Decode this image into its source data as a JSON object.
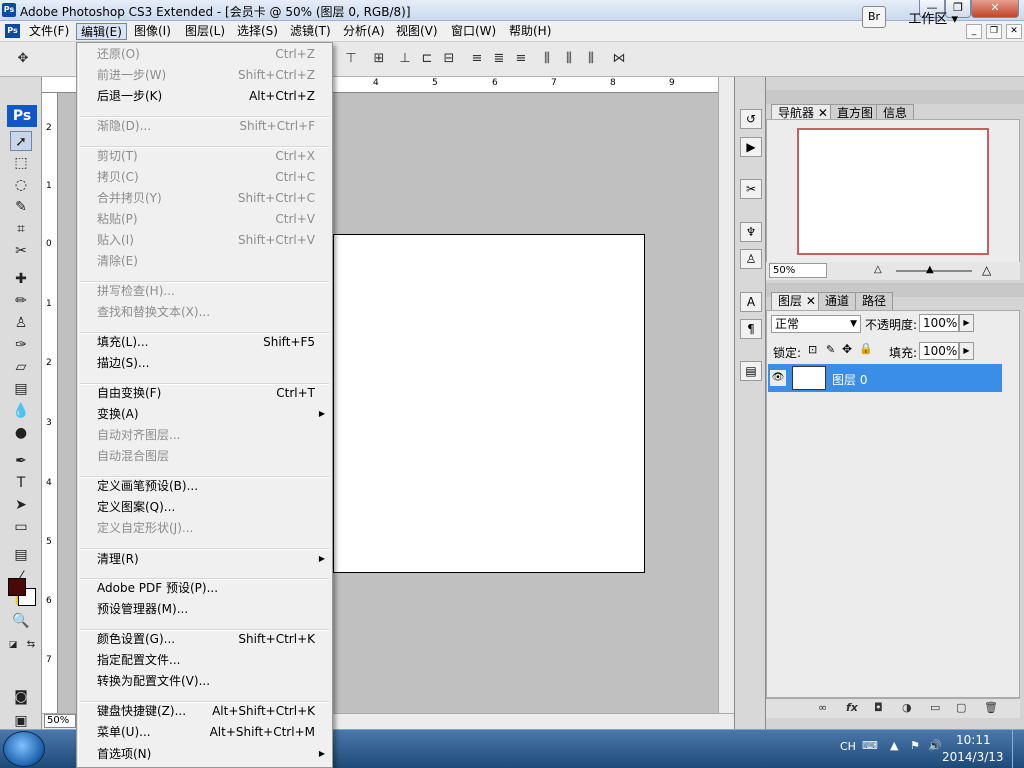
{
  "window": {
    "title": "Adobe Photoshop CS3 Extended - [会员卡 @ 50% (图层 0, RGB/8)]",
    "app_icon": "Ps",
    "controls": [
      "minimize",
      "maximize",
      "close"
    ]
  },
  "menubar": [
    {
      "label": "文件(F)"
    },
    {
      "label": "编辑(E)",
      "active": true
    },
    {
      "label": "图像(I)"
    },
    {
      "label": "图层(L)"
    },
    {
      "label": "选择(S)"
    },
    {
      "label": "滤镜(T)"
    },
    {
      "label": "分析(A)"
    },
    {
      "label": "视图(V)"
    },
    {
      "label": "窗口(W)"
    },
    {
      "label": "帮助(H)"
    }
  ],
  "options_bar": {
    "workspace_label": "工作区 ▾"
  },
  "edit_menu": [
    {
      "label": "还原(O)",
      "shortcut": "Ctrl+Z",
      "disabled": true
    },
    {
      "label": "前进一步(W)",
      "shortcut": "Shift+Ctrl+Z",
      "disabled": true
    },
    {
      "label": "后退一步(K)",
      "shortcut": "Alt+Ctrl+Z",
      "disabled": false
    },
    {
      "label": "渐隐(D)...",
      "shortcut": "Shift+Ctrl+F",
      "disabled": true
    },
    {
      "label": "剪切(T)",
      "shortcut": "Ctrl+X",
      "disabled": true
    },
    {
      "label": "拷贝(C)",
      "shortcut": "Ctrl+C",
      "disabled": true
    },
    {
      "label": "合并拷贝(Y)",
      "shortcut": "Shift+Ctrl+C",
      "disabled": true
    },
    {
      "label": "粘贴(P)",
      "shortcut": "Ctrl+V",
      "disabled": true
    },
    {
      "label": "贴入(I)",
      "shortcut": "Shift+Ctrl+V",
      "disabled": true
    },
    {
      "label": "清除(E)",
      "shortcut": "",
      "disabled": true
    },
    {
      "label": "拼写检查(H)...",
      "shortcut": "",
      "disabled": true
    },
    {
      "label": "查找和替换文本(X)...",
      "shortcut": "",
      "disabled": true
    },
    {
      "label": "填充(L)...",
      "shortcut": "Shift+F5",
      "disabled": false
    },
    {
      "label": "描边(S)...",
      "shortcut": "",
      "disabled": false
    },
    {
      "label": "自由变换(F)",
      "shortcut": "Ctrl+T",
      "disabled": false
    },
    {
      "label": "变换(A)",
      "shortcut": "",
      "disabled": false,
      "submenu": true
    },
    {
      "label": "自动对齐图层...",
      "shortcut": "",
      "disabled": true
    },
    {
      "label": "自动混合图层",
      "shortcut": "",
      "disabled": true
    },
    {
      "label": "定义画笔预设(B)...",
      "shortcut": "",
      "disabled": false
    },
    {
      "label": "定义图案(Q)...",
      "shortcut": "",
      "disabled": false
    },
    {
      "label": "定义自定形状(J)...",
      "shortcut": "",
      "disabled": true
    },
    {
      "label": "清理(R)",
      "shortcut": "",
      "disabled": false,
      "submenu": true
    },
    {
      "label": "Adobe PDF 预设(P)...",
      "shortcut": "",
      "disabled": false
    },
    {
      "label": "预设管理器(M)...",
      "shortcut": "",
      "disabled": false
    },
    {
      "label": "颜色设置(G)...",
      "shortcut": "Shift+Ctrl+K",
      "disabled": false
    },
    {
      "label": "指定配置文件...",
      "shortcut": "",
      "disabled": false
    },
    {
      "label": "转换为配置文件(V)...",
      "shortcut": "",
      "disabled": false
    },
    {
      "label": "键盘快捷键(Z)...",
      "shortcut": "Alt+Shift+Ctrl+K",
      "disabled": false
    },
    {
      "label": "菜单(U)...",
      "shortcut": "Alt+Shift+Ctrl+M",
      "disabled": false
    },
    {
      "label": "首选项(N)",
      "shortcut": "",
      "disabled": false,
      "submenu": true
    }
  ],
  "document": {
    "zoom": "50%",
    "ruler_top": [
      "4",
      "5",
      "6",
      "7",
      "8",
      "9"
    ],
    "ruler_left": [
      "2",
      "1",
      "0",
      "1",
      "2",
      "3",
      "4",
      "5",
      "6",
      "7"
    ]
  },
  "navigator_panel": {
    "tabs": [
      "导航器",
      "直方图",
      "信息"
    ],
    "zoom": "50%"
  },
  "layers_panel": {
    "tabs": [
      "图层",
      "通道",
      "路径"
    ],
    "blend_mode": "正常",
    "opacity_label": "不透明度:",
    "opacity": "100%",
    "lock_label": "锁定:",
    "fill_label": "填充:",
    "fill": "100%",
    "layers": [
      {
        "name": "图层 0",
        "visible": true,
        "selected": true
      }
    ]
  },
  "taskbar": {
    "lang": "CH",
    "time": "10:11",
    "date": "2014/3/13"
  },
  "colors": {
    "foreground": "#4a0808",
    "background": "#ffffff",
    "selection": "#3a8ee6"
  }
}
